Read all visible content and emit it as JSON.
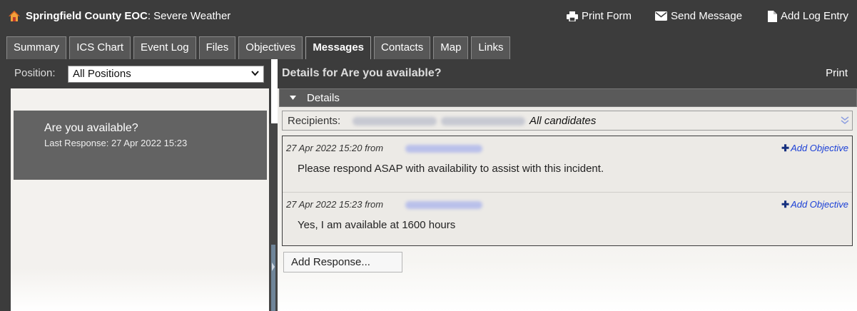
{
  "header": {
    "org_name": "Springfield County EOC",
    "event_name": ": Severe Weather",
    "actions": [
      {
        "label": "Print Form",
        "icon": "print-icon"
      },
      {
        "label": "Send Message",
        "icon": "envelope-icon"
      },
      {
        "label": "Add Log Entry",
        "icon": "document-icon"
      }
    ]
  },
  "tabs": [
    {
      "label": "Summary"
    },
    {
      "label": "ICS Chart"
    },
    {
      "label": "Event Log"
    },
    {
      "label": "Files"
    },
    {
      "label": "Objectives"
    },
    {
      "label": "Messages",
      "active": true
    },
    {
      "label": "Contacts"
    },
    {
      "label": "Map"
    },
    {
      "label": "Links"
    }
  ],
  "left": {
    "position_label": "Position:",
    "position_value": "All Positions",
    "messages": [
      {
        "subject": "Are you available?",
        "last_response": "Last Response: 27 Apr 2022 15:23"
      }
    ]
  },
  "details": {
    "title": "Details for Are you available?",
    "print_label": "Print",
    "section_label": "Details",
    "recipients_label": "Recipients:",
    "recipients_all": "All candidates",
    "entries": [
      {
        "meta": "27 Apr 2022 15:20 from",
        "text": "Please respond ASAP with availability to assist with this incident.",
        "add_objective": "Add Objective"
      },
      {
        "meta": "27 Apr 2022 15:23 from",
        "text": "Yes, I am available at 1600 hours",
        "add_objective": "Add Objective"
      }
    ],
    "add_response_label": "Add Response..."
  },
  "colors": {
    "header_bg": "#3c3c3c",
    "selected_item_bg": "#636363",
    "link_blue": "#1a3fd6"
  }
}
